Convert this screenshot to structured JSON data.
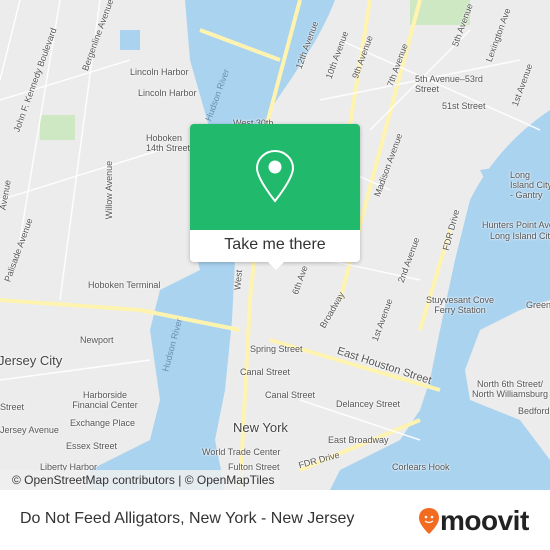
{
  "map": {
    "colors": {
      "water": "#aad3f0",
      "land": "#ececec",
      "road": "#fff3b0",
      "park": "#cfe8c4",
      "accent": "#21b96b",
      "brand": "#f26b21"
    },
    "labels": [
      "12th Avenue",
      "10th Avenue",
      "9th Avenue",
      "7th Avenue",
      "5th Avenue",
      "Lexington Ave",
      "1st Avenue",
      "5th Avenue–53rd Street",
      "51st Street",
      "Lincoln Harbor",
      "Lincoln Harbor",
      "Hudson River",
      "West 30th",
      "Hoboken 14th Street",
      "Willow Avenue",
      "Madison Avenue",
      "Long Island City - Gantry",
      "Hunters Point Avenue",
      "Long Island City",
      "FDR Drive",
      "2nd Avenue",
      "Hoboken Terminal",
      "6th Ave",
      "Broadway",
      "Stuyvesant Cove Ferry Station",
      "Greenpoint",
      "Jersey City",
      "Newport",
      "Hudson River",
      "Spring Street",
      "East Houston Street",
      "1st Avenue",
      "Canal Street",
      "Canal Street",
      "Delancey Street",
      "North 6th Street/ North Williamsburg",
      "Bedford",
      "Harborside Financial Center",
      "Exchange Place",
      "Essex Street",
      "New York",
      "World Trade Center",
      "Fulton Street",
      "East Broadway",
      "FDR Drive",
      "Corlears Hook",
      "John F. Kennedy Boulevard",
      "Bergenline Avenue",
      "Palisade Avenue",
      "Avenue",
      "West",
      "Street",
      "Jersey Avenue",
      "Liberty Harbor"
    ],
    "attribution": "© OpenStreetMap contributors | © OpenMapTiles"
  },
  "popup": {
    "icon": "map-pin-icon",
    "button_label": "Take me there"
  },
  "footer": {
    "title": "Do Not Feed Alligators, New York - New Jersey",
    "brand": "moovit"
  }
}
